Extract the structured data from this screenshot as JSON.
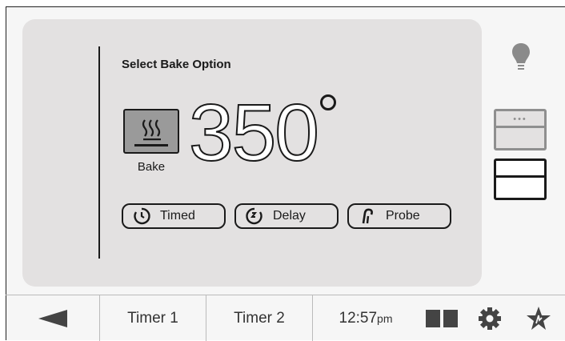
{
  "panel": {
    "title": "Select Bake Option",
    "bake_label": "Bake",
    "temperature": "350",
    "temperature_unit": "°",
    "options": [
      {
        "label": "Timed",
        "icon": "timer-icon"
      },
      {
        "label": "Delay",
        "icon": "delay-icon"
      },
      {
        "label": "Probe",
        "icon": "probe-icon"
      }
    ]
  },
  "left_controls": {
    "light_icon": "bulb-icon",
    "upper_oven_icon": "upper-oven-icon",
    "lower_oven_icon": "lower-oven-icon"
  },
  "right_controls": {
    "light_icon": "bulb-icon",
    "upper_oven_icon": "upper-oven-icon",
    "lower_oven_icon": "lower-oven-icon"
  },
  "bottom_bar": {
    "back_icon": "back-arrow-icon",
    "timer1_label": "Timer 1",
    "timer2_label": "Timer 2",
    "time": "12:57",
    "ampm": "pm",
    "icons": [
      "dual-panel-icon",
      "gear-icon",
      "favorite-star-icon"
    ]
  },
  "colors": {
    "panel_bg": "#e3e1e1",
    "bulb": "#8a8a8a",
    "inactive_oven": "#8f8f8f",
    "active_oven": "#1a1a1a"
  }
}
